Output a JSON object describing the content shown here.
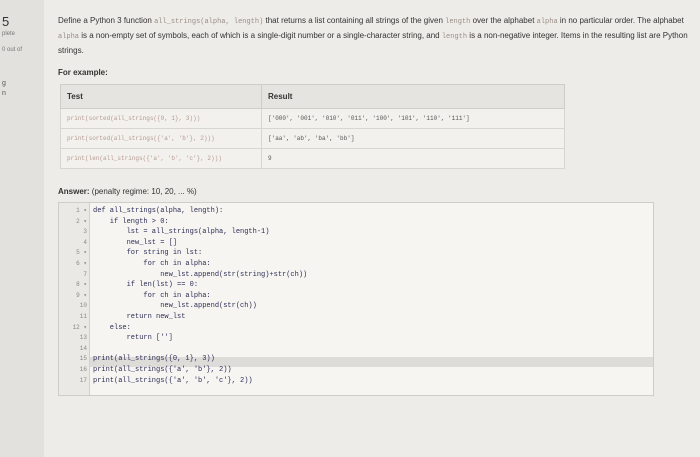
{
  "sidebar": {
    "question_number": "5",
    "status": "plete",
    "mark": "0 out of",
    "dot1": "g",
    "dot2": "n"
  },
  "question": {
    "text_1": "Define a Python 3 function ",
    "fn_sig": "all_strings(alpha, length)",
    "text_2": " that returns a list containing all strings of the given ",
    "length_word": "length",
    "text_3": " over the alphabet ",
    "alpha_word": "alpha",
    "text_4": " in no particular order. The alphabet ",
    "alpha_word_2": "alpha",
    "text_5": " is a non-empty set of symbols, each of which is a single-digit number or a single-character string, and ",
    "length_word_2": "length",
    "text_6": " is a non-negative integer. Items in the resulting list are Python strings.",
    "example_label": "For example:"
  },
  "examples": {
    "headers": [
      "Test",
      "Result"
    ],
    "rows": [
      {
        "test": "print(sorted(all_strings({0, 1}, 3)))",
        "result": "['000', '001', '010', '011', '100', '101', '110', '111']"
      },
      {
        "test": "print(sorted(all_strings({'a', 'b'}, 2)))",
        "result": "['aa', 'ab', 'ba', 'bb']"
      },
      {
        "test": "print(len(all_strings({'a', 'b', 'c'}, 2)))",
        "result": "9"
      }
    ]
  },
  "answer": {
    "label": "Answer:",
    "regime": " (penalty regime: 10, 20, ... %)"
  },
  "editor": {
    "lines": [
      {
        "n": "1 ▾",
        "code": "def all_strings(alpha, length):"
      },
      {
        "n": "2 ▾",
        "code": "    if length > 0:"
      },
      {
        "n": "3",
        "code": "        lst = all_strings(alpha, length-1)"
      },
      {
        "n": "4",
        "code": "        new_lst = []"
      },
      {
        "n": "5 ▾",
        "code": "        for string in lst:"
      },
      {
        "n": "6 ▾",
        "code": "            for ch in alpha:"
      },
      {
        "n": "7",
        "code": "                new_lst.append(str(string)+str(ch))"
      },
      {
        "n": "8 ▾",
        "code": "        if len(lst) == 0:"
      },
      {
        "n": "9 ▾",
        "code": "            for ch in alpha:"
      },
      {
        "n": "10",
        "code": "                new_lst.append(str(ch))"
      },
      {
        "n": "11",
        "code": "        return new_lst"
      },
      {
        "n": "12 ▾",
        "code": "    else:"
      },
      {
        "n": "13",
        "code": "        return ['']"
      },
      {
        "n": "14",
        "code": ""
      },
      {
        "n": "15",
        "code": "print(all_strings({0, 1}, 3))"
      },
      {
        "n": "16",
        "code": "print(all_strings({'a', 'b'}, 2))"
      },
      {
        "n": "17",
        "code": "print(all_strings({'a', 'b', 'c'}, 2))"
      }
    ]
  }
}
